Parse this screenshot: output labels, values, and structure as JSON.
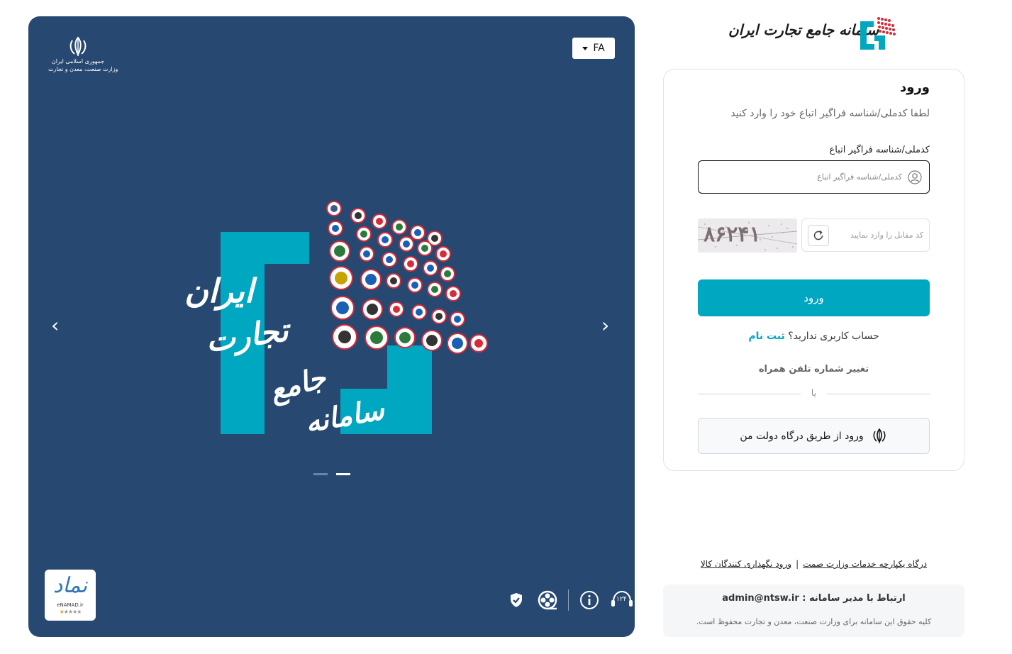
{
  "banner": {
    "emblem_line1": "جمهوری اسلامی ایران",
    "emblem_line2": "وزارت صنعت، معدن و تجارت",
    "lang_label": "FA",
    "prev_arrow": "‹",
    "next_arrow": "›",
    "slide_text1": "ایران",
    "slide_text2": "تجارت",
    "slide_text3": "جامع",
    "slide_text4": "سامانه",
    "enamad_mark": "نماد",
    "enamad_site": "eNAMAD.ir",
    "enamad_stars_on": "★",
    "enamad_stars_off": "★★★★",
    "support_number": "۱۲۴",
    "icons": [
      "shield-check-icon",
      "film-reel-icon",
      "info-icon",
      "headset-icon"
    ]
  },
  "brand": {
    "name": "سامانه جامع تجارت ایران"
  },
  "login": {
    "title": "ورود",
    "hint": "لطفا کدملی/شناسه فراگیر اتباع خود را وارد کنید",
    "field_label": "کدملی/شناسه فراگیر اتباع",
    "field_placeholder": "کدملی/شناسه فراگیر اتباع",
    "captcha_placeholder": "کد مقابل را وارد نمایید",
    "captcha_code": "۸۶۲۴۱",
    "submit_label": "ورود",
    "no_account_text": "حساب کاربری ندارید؟",
    "signup_link": "ثبت نام",
    "change_phone": "تغییر شماره تلفن همراه",
    "or_text": "یا",
    "gov_login": "ورود از طریق درگاه دولت من"
  },
  "footer": {
    "link1": "درگاه یکپارچه خدمات وزارت صمت",
    "separator": "|",
    "link2": "ورود نگهداری کنندگان کالا",
    "contact": "ارتباط با مدیر سامانه : admin@ntsw.ir",
    "copyright": "کلیه حقوق این سامانه برای وزارت صنعت، معدن و تجارت محفوظ است."
  },
  "colors": {
    "banner_bg": "#274870",
    "accent": "#00a7c1",
    "badge_border": "#d62b3a"
  }
}
